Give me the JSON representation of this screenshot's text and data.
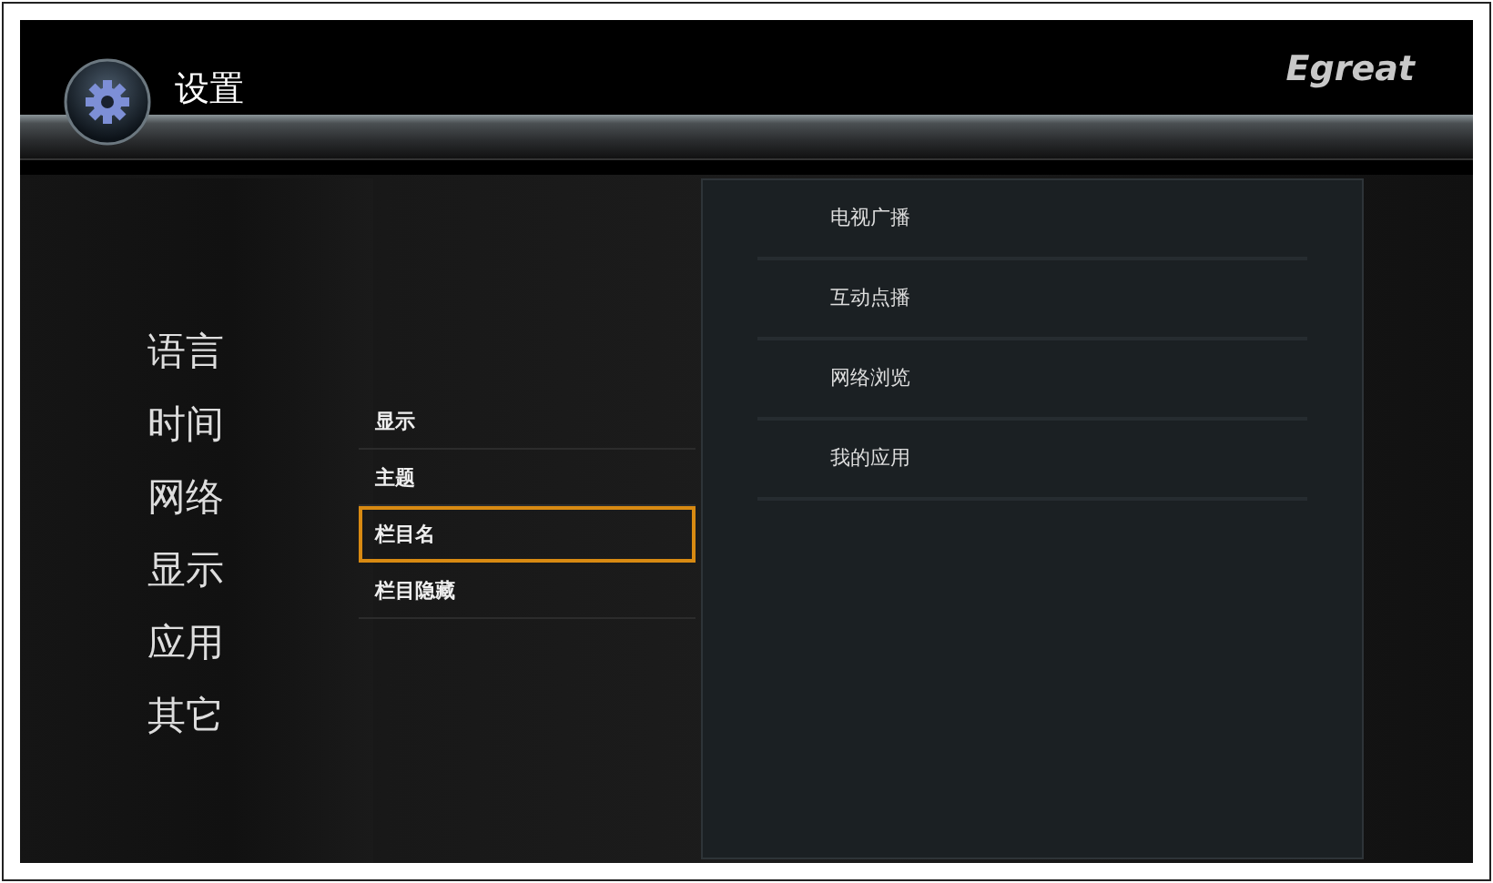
{
  "header": {
    "title": "设置",
    "brand": "Egreat"
  },
  "categories": [
    {
      "label": "语言"
    },
    {
      "label": "时间"
    },
    {
      "label": "网络"
    },
    {
      "label": "显示"
    },
    {
      "label": "应用"
    },
    {
      "label": "其它"
    }
  ],
  "options": [
    {
      "label": "显示",
      "selected": false
    },
    {
      "label": "主题",
      "selected": false
    },
    {
      "label": "栏目名",
      "selected": true
    },
    {
      "label": "栏目隐藏",
      "selected": false
    }
  ],
  "values": [
    {
      "label": "电视广播"
    },
    {
      "label": "互动点播"
    },
    {
      "label": "网络浏览"
    },
    {
      "label": "我的应用"
    }
  ]
}
